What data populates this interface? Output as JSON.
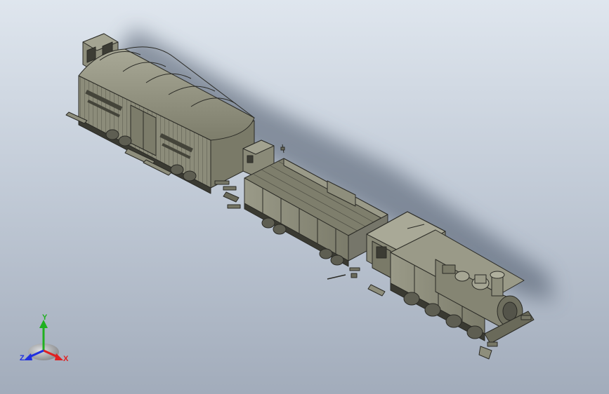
{
  "viewport": {
    "background_top": "#dfe6ee",
    "background_bottom": "#a2acbb",
    "model_fill": "#8e8e7c",
    "model_edge": "#2b2b26"
  },
  "model": {
    "parts": [
      "boxcar",
      "open-wagon",
      "steam-locomotive"
    ]
  },
  "triad": {
    "x_label": "X",
    "y_label": "Y",
    "z_label": "Z",
    "x_color": "#e02020",
    "y_color": "#20b020",
    "z_color": "#2030e0"
  }
}
